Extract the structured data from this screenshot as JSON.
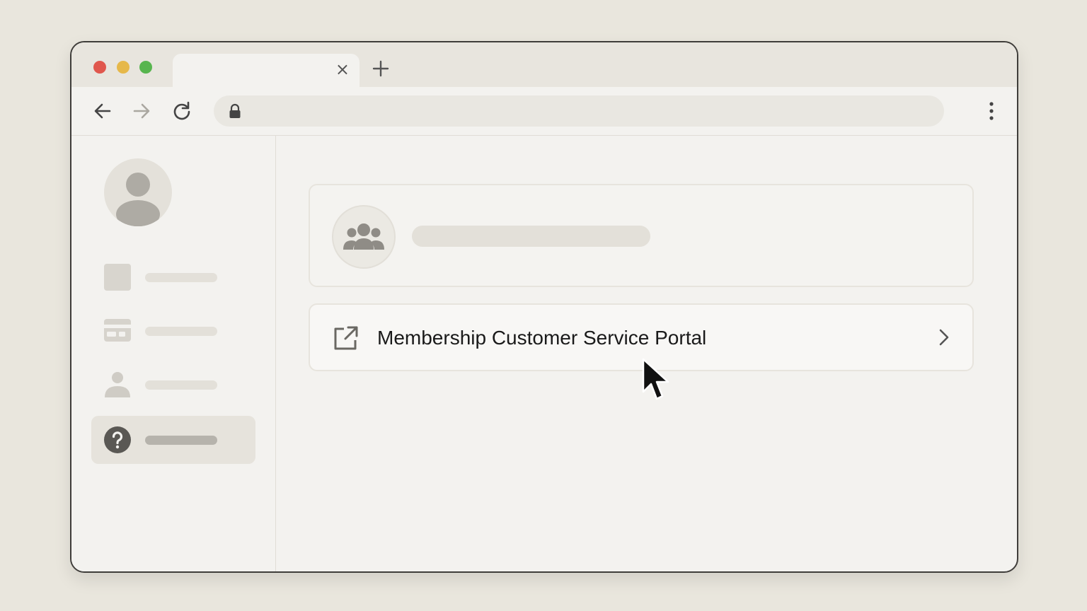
{
  "browser": {
    "tab_close_glyph": "×",
    "icons": {
      "back": "arrow-left-icon",
      "forward": "arrow-right-icon",
      "reload": "reload-icon",
      "lock": "lock-icon",
      "menu": "kebab-menu-icon",
      "new_tab": "plus-icon"
    }
  },
  "sidebar": {
    "items": [
      {
        "icon": "square-icon"
      },
      {
        "icon": "card-icon"
      },
      {
        "icon": "person-icon"
      },
      {
        "icon": "help-icon",
        "active": true
      }
    ]
  },
  "main": {
    "link_card": {
      "label": "Membership Customer Service Portal",
      "icon": "external-link-icon"
    }
  },
  "colors": {
    "traffic_red": "#e0574d",
    "traffic_yellow": "#e6b84a",
    "traffic_green": "#57b54e"
  }
}
